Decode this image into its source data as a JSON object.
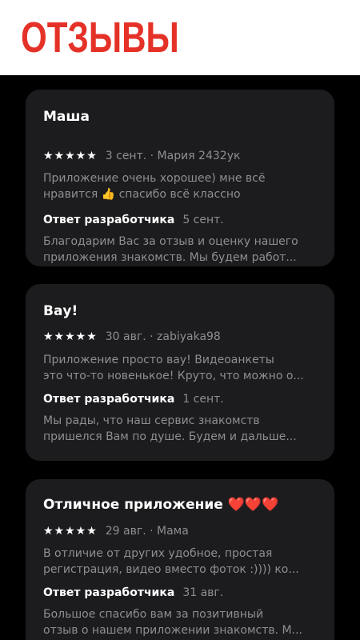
{
  "header": {
    "title": "ОТЗЫВЫ"
  },
  "reviews": [
    {
      "title": "Маша",
      "stars": "★★★★★",
      "meta": "3 сент. · Мария 2432ук",
      "body_line1": "Приложение очень хорошее) мне всё",
      "body_line2": "нравится 👍 спасибо всё классно",
      "reply_label": "Ответ разработчика",
      "reply_date": "5 сент.",
      "reply_line1": "Благодарим Вас за отзыв и оценку нашего",
      "reply_line2": "приложения знакомств. Мы будем работ..."
    },
    {
      "title": "Вау!",
      "stars": "★★★★★",
      "meta": "30 авг. · zabiyaka98",
      "body_line1": "Приложение просто вау! Видеоанкеты",
      "body_line2": "это что-то новенькое! Круто, что можно о...",
      "reply_label": "Ответ разработчика",
      "reply_date": "1 сент.",
      "reply_line1": "Мы рады, что наш сервис знакомств",
      "reply_line2": "пришелся Вам по душе. Будем и дальше..."
    },
    {
      "title": "Отличное приложение ❤️❤️❤️",
      "stars": "★★★★★",
      "meta": "29 авг. · Мама",
      "body_line1": "В отличие от других удобное, простая",
      "body_line2": "регистрация, видео вместо фоток :)))) ко...",
      "reply_label": "Ответ разработчика",
      "reply_date": "31 авг.",
      "reply_line1": "Большое спасибо вам за позитивный",
      "reply_line2": "отзыв о нашем приложении знакомств. М..."
    }
  ]
}
